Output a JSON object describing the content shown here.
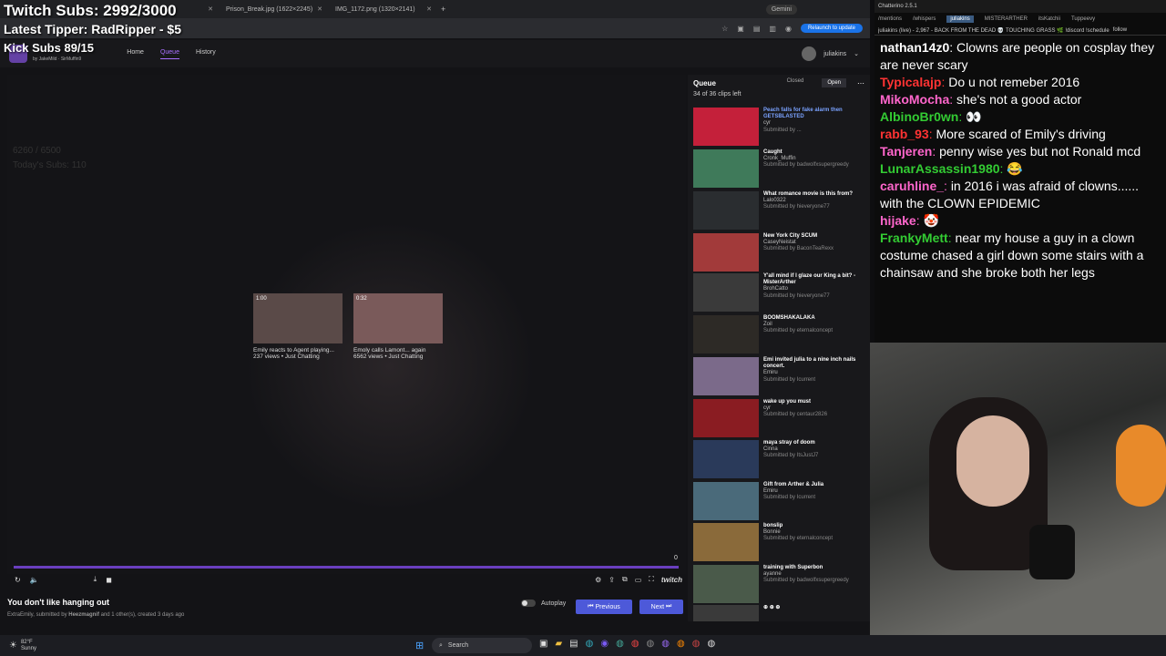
{
  "overlay": {
    "subs_line": "Twitch Subs: 2992/3000",
    "tipper_line": "Latest Tipper: RadRipper - $5",
    "kick_line": "Kick Subs 89/15"
  },
  "browser": {
    "tabs": [
      {
        "label": ""
      },
      {
        "label": "Prison_Break.jpg (1622×2245)"
      },
      {
        "label": "IMG_1172.png (1320×2141)"
      }
    ],
    "gemini_label": "Gemini",
    "relaunch_label": "Relaunch to update"
  },
  "site": {
    "authors": "by JakeMild · SirMuffin9",
    "nav": {
      "home": "Home",
      "queue": "Queue",
      "history": "History"
    },
    "username": "juliakins"
  },
  "player": {
    "faded_counter": "6260 / 6500",
    "faded_subs": "Today's Subs: 110",
    "progress_end": "0",
    "related": [
      {
        "time": "1:00",
        "title": "Emily reacts to Agent playing...",
        "meta": "237 views • Just Chatting"
      },
      {
        "time": "0:32",
        "title": "Emoly calls Lamont... again",
        "meta": "6562 views • Just Chatting"
      }
    ],
    "brand": "twitch"
  },
  "clip": {
    "title": "You don't like hanging out",
    "channel": "ExtraEmily",
    "meta_mid": ", submitted by ",
    "submitter": "Heezmagnif",
    "meta_tail": " and 1 other(s), created 3 days ago"
  },
  "controls": {
    "autoplay_label": "Autoplay",
    "previous_label": "Previous",
    "next_label": "Next"
  },
  "queue": {
    "title": "Queue",
    "closed_label": "Closed",
    "open_label": "Open",
    "count": "34 of 36 clips left",
    "items": [
      {
        "title": "Peach falls for fake alarm then GETSBLASTED",
        "creator": "cyr",
        "by": "Submitted by ...",
        "color": "#c4203a"
      },
      {
        "title": "Caught",
        "creator": "Cronk_Muffin",
        "by": "Submitted by badwolfxsupergreedy",
        "color": "#3f7a5a"
      },
      {
        "title": "What romance movie is this from?",
        "creator": "Lalo0322",
        "by": "Submitted by hieveryone77",
        "color": "#2a2d30"
      },
      {
        "title": "New York City SCUM",
        "creator": "CaseyNeistat",
        "by": "Submitted by BaconTeaRexx",
        "color": "#a23a3a"
      },
      {
        "title": "Y'all mind if I glaze our King a bit? - MisterArther",
        "creator": "BrohCatto",
        "by": "Submitted by hieveryone77",
        "color": "#3a3a3a"
      },
      {
        "title": "BOOMSHAKALAKA",
        "creator": "Zoil",
        "by": "Submitted by eternalconcept",
        "color": "#2d2a26"
      },
      {
        "title": "Emi invited julia to a nine inch nails concert.",
        "creator": "Emiru",
        "by": "Submitted by Icurrent",
        "color": "#7b6a8a"
      },
      {
        "title": "wake up you must",
        "creator": "cyr",
        "by": "Submitted by centaur2826",
        "color": "#8a1c22"
      },
      {
        "title": "maya stray of doom",
        "creator": "Cinna",
        "by": "Submitted by ItsJustJ7",
        "color": "#2a3a5a"
      },
      {
        "title": "Gift from Arther & Julia",
        "creator": "Emiru",
        "by": "Submitted by Icurrent",
        "color": "#4a6a7a"
      },
      {
        "title": "bonslip",
        "creator": "Bonnie",
        "by": "Submitted by eternalconcept",
        "color": "#8a6a3a"
      },
      {
        "title": "training with Superbon",
        "creator": "ayanne",
        "by": "Submitted by badwolfxsupergreedy",
        "color": "#4a5a4a"
      },
      {
        "title": "⊕ ⊕ ⊕",
        "creator": "",
        "by": "",
        "color": "#3a3a3a"
      }
    ]
  },
  "chat": {
    "app_title": "Chatterino 2.5.1",
    "tabs": [
      "/mentions",
      "/whispers",
      "juliakins",
      "MISTERARTHER",
      "itsKatchii",
      "Tuppeevy"
    ],
    "status": "juliakins (live) - 2,967 - BACK FROM THE DEAD 💀 TOUCHING GRASS 🌿 !discord !schedule",
    "follow": "follow",
    "messages": [
      {
        "user": "nathan14z0",
        "color": "#ffffff",
        "text": "Clowns are people on cosplay they are never scary"
      },
      {
        "user": "Typicalajp",
        "color": "#ff3333",
        "text": "Do u not remeber 2016"
      },
      {
        "user": "MikoMocha",
        "color": "#ff66cc",
        "text": "she's not a good actor"
      },
      {
        "user": "AlbinoBr0wn",
        "color": "#33cc33",
        "text": "👀"
      },
      {
        "user": "rabb_93",
        "color": "#ff3333",
        "text": "More scared of Emily's driving"
      },
      {
        "user": "Tanjeren",
        "color": "#ff66cc",
        "text": "penny wise yes but not Ronald mcd"
      },
      {
        "user": "LunarAssassin1980",
        "color": "#33cc33",
        "text": "😂"
      },
      {
        "user": "caruhline_",
        "color": "#ff66cc",
        "text": "in 2016 i was afraid of clowns...... with the CLOWN EPIDEMIC"
      },
      {
        "user": "hijake",
        "color": "#ff66cc",
        "text": "🤡"
      },
      {
        "user": "FrankyMett",
        "color": "#33cc33",
        "text": "near my house a guy in a clown costume chased a girl down some stairs with a chainsaw and she broke both her legs"
      }
    ]
  },
  "taskbar": {
    "temp": "82°F",
    "weather": "Sunny",
    "search": "Search"
  }
}
